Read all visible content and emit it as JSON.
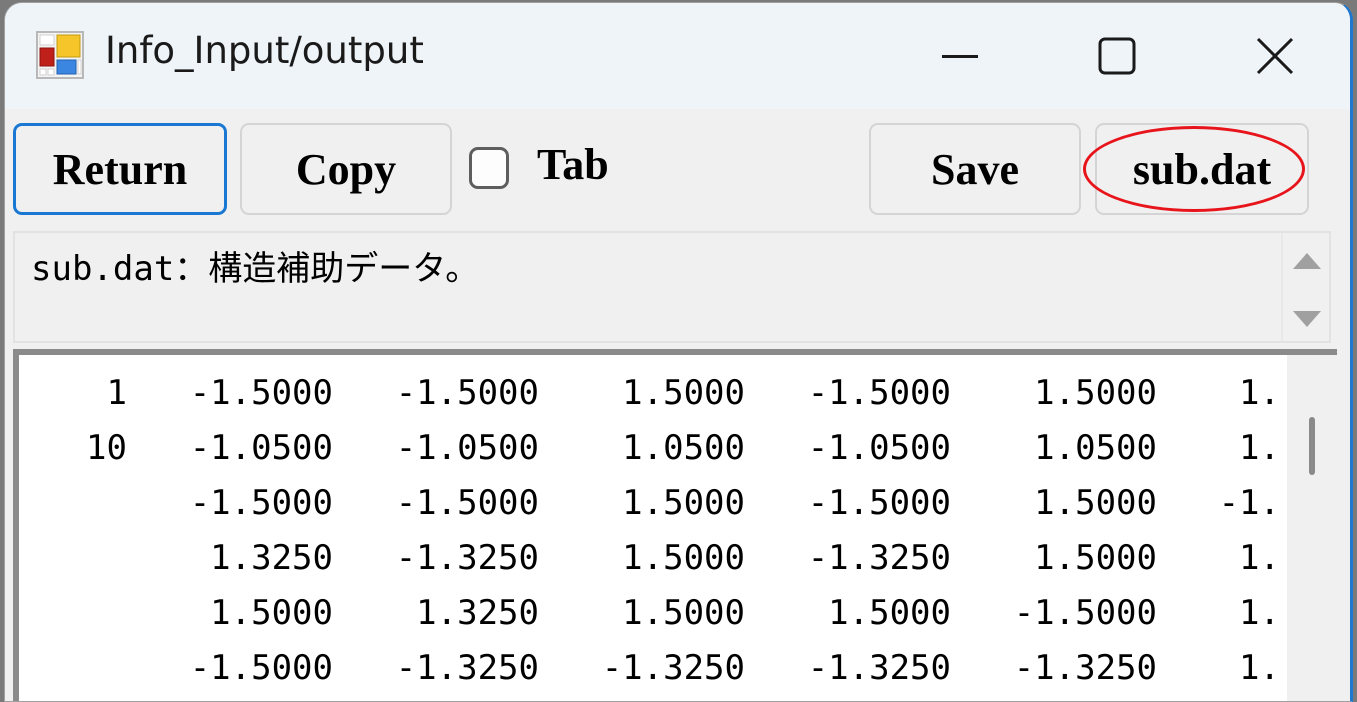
{
  "window": {
    "title": "Info_Input/output",
    "controls": {
      "minimize": "minimize",
      "maximize": "maximize",
      "close": "close"
    }
  },
  "toolbar": {
    "return_label": "Return",
    "copy_label": "Copy",
    "tab_checkbox": {
      "label": "Tab",
      "checked": false
    },
    "save_label": "Save",
    "subdat_label": "sub.dat"
  },
  "annotation": {
    "highlighted": "sub.dat",
    "color": "#e8141b"
  },
  "description": "sub.dat：構造補助データ。",
  "data_rows": [
    [
      "1",
      "-1.5000",
      "-1.5000",
      "1.5000",
      "-1.5000",
      "1.5000",
      "1."
    ],
    [
      "10",
      "-1.0500",
      "-1.0500",
      "1.0500",
      "-1.0500",
      "1.0500",
      "1."
    ],
    [
      "",
      "-1.5000",
      "-1.5000",
      "1.5000",
      "-1.5000",
      "1.5000",
      "-1."
    ],
    [
      "",
      "1.3250",
      "-1.3250",
      "1.5000",
      "-1.3250",
      "1.5000",
      "1."
    ],
    [
      "",
      "1.5000",
      "1.3250",
      "1.5000",
      "1.5000",
      "-1.5000",
      "1."
    ],
    [
      "",
      "-1.5000",
      "-1.3250",
      "-1.3250",
      "-1.3250",
      "-1.3250",
      "1."
    ]
  ]
}
